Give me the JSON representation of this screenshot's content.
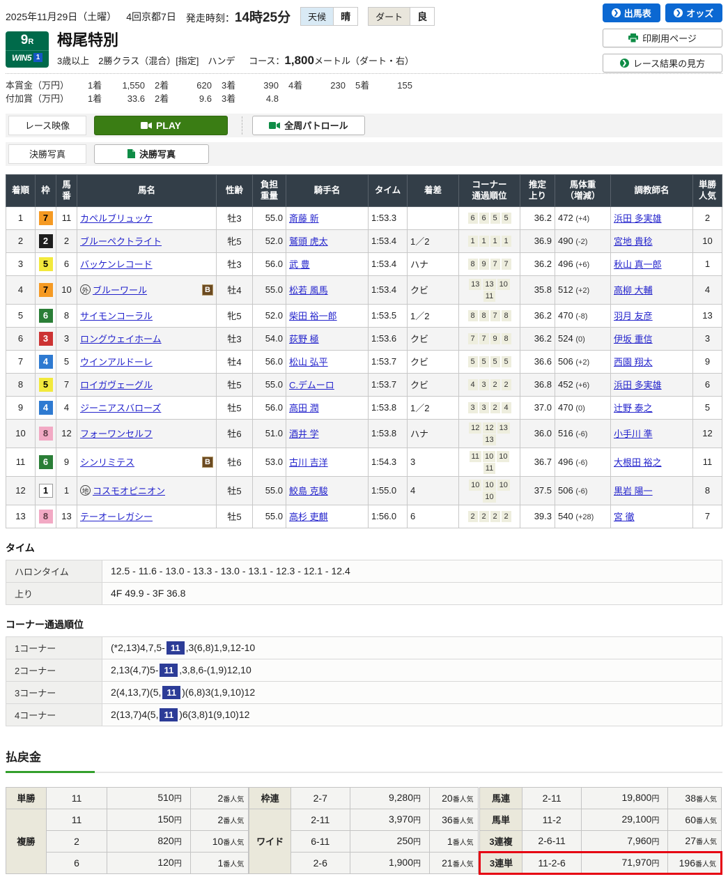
{
  "top": {
    "date": "2025年11月29日（土曜）",
    "meeting": "4回京都7日",
    "start_label": "発走時刻：",
    "start_time": "14時25分",
    "weather_label": "天候",
    "weather_value": "晴",
    "track_label": "ダート",
    "track_value": "良",
    "btn_entries": "出馬表",
    "btn_odds": "オッズ",
    "btn_print": "印刷用ページ",
    "btn_guide": "レース結果の見方"
  },
  "race": {
    "number": "9",
    "number_suffix": "R",
    "win5": "WIN5",
    "win5_num": "1",
    "title": "栂尾特別",
    "conditions": "3歳以上　2勝クラス（混合）[指定]　ハンデ",
    "course_label": "コース：",
    "course_value": "1,800",
    "course_suffix": "メートル（ダート・右）"
  },
  "prize": {
    "main_label": "本賞金（万円）",
    "main_items": [
      {
        "rank": "1着",
        "value": "1,550"
      },
      {
        "rank": "2着",
        "value": "620"
      },
      {
        "rank": "3着",
        "value": "390"
      },
      {
        "rank": "4着",
        "value": "230"
      },
      {
        "rank": "5着",
        "value": "155"
      }
    ],
    "fuka_label": "付加賞（万円）",
    "fuka_items": [
      {
        "rank": "1着",
        "value": "33.6"
      },
      {
        "rank": "2着",
        "value": "9.6"
      },
      {
        "rank": "3着",
        "value": "4.8"
      }
    ]
  },
  "media": {
    "video_label": "レース映像",
    "play_label": "PLAY",
    "patrol_label": "全周パトロール",
    "photo_label": "決勝写真",
    "photo_button": "決勝写真"
  },
  "results": {
    "headers": [
      "着順",
      "枠",
      "馬\n番",
      "馬名",
      "性齢",
      "負担\n重量",
      "騎手名",
      "タイム",
      "着差",
      "コーナー\n通過順位",
      "推定\n上り",
      "馬体重\n（増減）",
      "調教師名",
      "単勝\n人気"
    ],
    "rows": [
      {
        "pos": "1",
        "waku": 7,
        "num": "11",
        "mark": "",
        "name": "カペルブリュッケ",
        "blinker": false,
        "sexage": "牡3",
        "weight": "55.0",
        "jockey": "斎藤 新",
        "time": "1:53.3",
        "margin": "",
        "corners": [
          "6",
          "6",
          "5",
          "5"
        ],
        "agari": "36.2",
        "body": "472",
        "diff": "(+4)",
        "trainer": "浜田 多実雄",
        "pop": "2"
      },
      {
        "pos": "2",
        "waku": 2,
        "num": "2",
        "mark": "",
        "name": "ブルーペクトライト",
        "blinker": false,
        "sexage": "牝5",
        "weight": "52.0",
        "jockey": "鷲頭 虎太",
        "time": "1:53.4",
        "margin": "1／2",
        "corners": [
          "1",
          "1",
          "1",
          "1"
        ],
        "agari": "36.9",
        "body": "490",
        "diff": "(-2)",
        "trainer": "宮地 貴稔",
        "pop": "10"
      },
      {
        "pos": "3",
        "waku": 5,
        "num": "6",
        "mark": "",
        "name": "バッケンレコード",
        "blinker": false,
        "sexage": "牡3",
        "weight": "56.0",
        "jockey": "武 豊",
        "time": "1:53.4",
        "margin": "ハナ",
        "corners": [
          "8",
          "9",
          "7",
          "7"
        ],
        "agari": "36.2",
        "body": "496",
        "diff": "(+6)",
        "trainer": "秋山 真一郎",
        "pop": "1"
      },
      {
        "pos": "4",
        "waku": 7,
        "num": "10",
        "mark": "外",
        "name": "ブルーワール",
        "blinker": true,
        "sexage": "牡4",
        "weight": "55.0",
        "jockey": "松若 風馬",
        "time": "1:53.4",
        "margin": "クビ",
        "corners": [
          "13",
          "13",
          "10",
          "11"
        ],
        "agari": "35.8",
        "body": "512",
        "diff": "(+2)",
        "trainer": "高柳 大輔",
        "pop": "4"
      },
      {
        "pos": "5",
        "waku": 6,
        "num": "8",
        "mark": "",
        "name": "サイモンコーラル",
        "blinker": false,
        "sexage": "牝5",
        "weight": "52.0",
        "jockey": "柴田 裕一郎",
        "time": "1:53.5",
        "margin": "1／2",
        "corners": [
          "8",
          "8",
          "7",
          "8"
        ],
        "agari": "36.2",
        "body": "470",
        "diff": "(-8)",
        "trainer": "羽月 友彦",
        "pop": "13"
      },
      {
        "pos": "6",
        "waku": 3,
        "num": "3",
        "mark": "",
        "name": "ロングウェイホーム",
        "blinker": false,
        "sexage": "牡3",
        "weight": "54.0",
        "jockey": "荻野 極",
        "time": "1:53.6",
        "margin": "クビ",
        "corners": [
          "7",
          "7",
          "9",
          "8"
        ],
        "agari": "36.2",
        "body": "524",
        "diff": "(0)",
        "trainer": "伊坂 重信",
        "pop": "3"
      },
      {
        "pos": "7",
        "waku": 4,
        "num": "5",
        "mark": "",
        "name": "ウインアルドーレ",
        "blinker": false,
        "sexage": "牡4",
        "weight": "56.0",
        "jockey": "松山 弘平",
        "time": "1:53.7",
        "margin": "クビ",
        "corners": [
          "5",
          "5",
          "5",
          "5"
        ],
        "agari": "36.6",
        "body": "506",
        "diff": "(+2)",
        "trainer": "西園 翔太",
        "pop": "9"
      },
      {
        "pos": "8",
        "waku": 5,
        "num": "7",
        "mark": "",
        "name": "ロイガヴェーグル",
        "blinker": false,
        "sexage": "牡5",
        "weight": "55.0",
        "jockey": "C.デムーロ",
        "time": "1:53.7",
        "margin": "クビ",
        "corners": [
          "4",
          "3",
          "2",
          "2"
        ],
        "agari": "36.8",
        "body": "452",
        "diff": "(+6)",
        "trainer": "浜田 多実雄",
        "pop": "6"
      },
      {
        "pos": "9",
        "waku": 4,
        "num": "4",
        "mark": "",
        "name": "ジーニアスバローズ",
        "blinker": false,
        "sexage": "牡5",
        "weight": "56.0",
        "jockey": "高田 潤",
        "time": "1:53.8",
        "margin": "1／2",
        "corners": [
          "3",
          "3",
          "2",
          "4"
        ],
        "agari": "37.0",
        "body": "470",
        "diff": "(0)",
        "trainer": "辻野 泰之",
        "pop": "5"
      },
      {
        "pos": "10",
        "waku": 8,
        "num": "12",
        "mark": "",
        "name": "フォーワンセルフ",
        "blinker": false,
        "sexage": "牡6",
        "weight": "51.0",
        "jockey": "酒井 学",
        "time": "1:53.8",
        "margin": "ハナ",
        "corners": [
          "12",
          "12",
          "13",
          "13"
        ],
        "agari": "36.0",
        "body": "516",
        "diff": "(-6)",
        "trainer": "小手川 準",
        "pop": "12"
      },
      {
        "pos": "11",
        "waku": 6,
        "num": "9",
        "mark": "",
        "name": "シンリミテス",
        "blinker": true,
        "sexage": "牡6",
        "weight": "53.0",
        "jockey": "古川 吉洋",
        "time": "1:54.3",
        "margin": "3",
        "corners": [
          "11",
          "10",
          "10",
          "11"
        ],
        "agari": "36.7",
        "body": "496",
        "diff": "(-6)",
        "trainer": "大根田 裕之",
        "pop": "11"
      },
      {
        "pos": "12",
        "waku": 1,
        "num": "1",
        "mark": "地",
        "name": "コスモオピニオン",
        "blinker": false,
        "sexage": "牡5",
        "weight": "55.0",
        "jockey": "鮫島 克駿",
        "time": "1:55.0",
        "margin": "4",
        "corners": [
          "10",
          "10",
          "10",
          "10"
        ],
        "agari": "37.5",
        "body": "506",
        "diff": "(-6)",
        "trainer": "黒岩 陽一",
        "pop": "8"
      },
      {
        "pos": "13",
        "waku": 8,
        "num": "13",
        "mark": "",
        "name": "テーオーレガシー",
        "blinker": false,
        "sexage": "牡5",
        "weight": "55.0",
        "jockey": "高杉 吏麒",
        "time": "1:56.0",
        "margin": "6",
        "corners": [
          "2",
          "2",
          "2",
          "2"
        ],
        "agari": "39.3",
        "body": "540",
        "diff": "(+28)",
        "trainer": "宮 徹",
        "pop": "7"
      }
    ]
  },
  "time_section": {
    "title": "タイム",
    "rows": [
      {
        "label": "ハロンタイム",
        "value": "12.5 - 11.6 - 13.0 - 13.3 - 13.0 - 13.1 - 12.3 - 12.1 - 12.4"
      },
      {
        "label": "上り",
        "value": "4F 49.9 - 3F 36.8"
      }
    ]
  },
  "corner_section": {
    "title": "コーナー通過順位",
    "highlight": "11",
    "rows": [
      {
        "label": "1コーナー",
        "pre": "(*2,13)4,7,5-",
        "post": ",3(6,8)1,9,12-10"
      },
      {
        "label": "2コーナー",
        "pre": "2,13(4,7)5-",
        "post": ",3,8,6-(1,9)12,10"
      },
      {
        "label": "3コーナー",
        "pre": "2(4,13,7)(5,",
        "post": ")(6,8)3(1,9,10)12"
      },
      {
        "label": "4コーナー",
        "pre": "2(13,7)4(5,",
        "post": ")6(3,8)1(9,10)12"
      }
    ]
  },
  "payout": {
    "title": "払戻金",
    "yen_suffix": "円",
    "pop_suffix": "番人気",
    "groups": [
      [
        {
          "label": "単勝",
          "rows": [
            {
              "combo": "11",
              "amount": "510",
              "pop": "2"
            }
          ]
        },
        {
          "label": "複勝",
          "rows": [
            {
              "combo": "11",
              "amount": "150",
              "pop": "2"
            },
            {
              "combo": "2",
              "amount": "820",
              "pop": "10"
            },
            {
              "combo": "6",
              "amount": "120",
              "pop": "1"
            }
          ]
        }
      ],
      [
        {
          "label": "枠連",
          "rows": [
            {
              "combo": "2-7",
              "amount": "9,280",
              "pop": "20"
            }
          ]
        },
        {
          "label": "ワイド",
          "rows": [
            {
              "combo": "2-11",
              "amount": "3,970",
              "pop": "36"
            },
            {
              "combo": "6-11",
              "amount": "250",
              "pop": "1"
            },
            {
              "combo": "2-6",
              "amount": "1,900",
              "pop": "21"
            }
          ]
        }
      ],
      [
        {
          "label": "馬連",
          "rows": [
            {
              "combo": "2-11",
              "amount": "19,800",
              "pop": "38"
            }
          ]
        },
        {
          "label": "馬単",
          "rows": [
            {
              "combo": "11-2",
              "amount": "29,100",
              "pop": "60"
            }
          ]
        },
        {
          "label": "3連複",
          "rows": [
            {
              "combo": "2-6-11",
              "amount": "7,960",
              "pop": "27"
            }
          ]
        },
        {
          "label": "3連単",
          "rows": [
            {
              "combo": "11-2-6",
              "amount": "71,970",
              "pop": "196",
              "hl": true
            }
          ]
        }
      ]
    ]
  },
  "colors": {
    "accent_blue": "#0b68d2",
    "green": "#006a4a",
    "play_green": "#3a7d14",
    "table_header": "#333e48",
    "highlight_red": "#e60012",
    "corner_highlight": "#2c3c97"
  }
}
